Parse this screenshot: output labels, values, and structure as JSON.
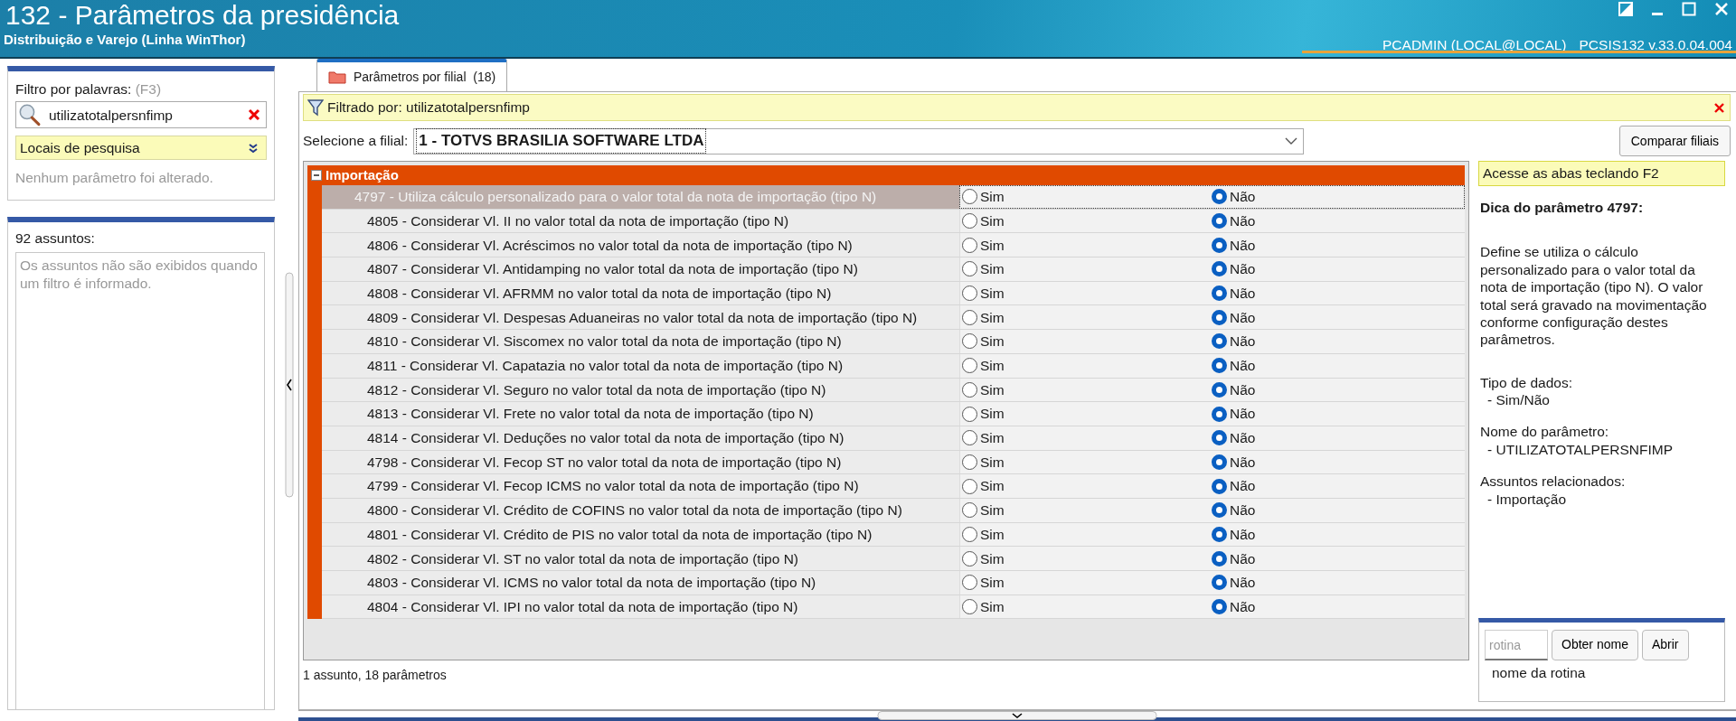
{
  "window": {
    "title": "132 - Parâmetros da presidência",
    "subtitle": "Distribuição e Varejo (Linha WinThor)",
    "user_info": "PCADMIN (LOCAL@LOCAL)",
    "version": "PCSIS132  v.33.0.04.004"
  },
  "filter_panel": {
    "label": "Filtro por palavras:",
    "shortcut": "(F3)",
    "search_value": "utilizatotalpersnfimp",
    "search_places": "Locais de pesquisa",
    "status": "Nenhum parâmetro foi alterado."
  },
  "subjects_panel": {
    "label": "92 assuntos:",
    "message": "Os assuntos não são exibidos quando um filtro é informado."
  },
  "tabs": [
    {
      "label": "Parâmetros por filial",
      "count": "(18)",
      "selected": true
    }
  ],
  "filter_bar": {
    "text": "Filtrado por: utilizatotalpersnfimp"
  },
  "branch": {
    "label": "Selecione a filial:",
    "value": "1 - TOTVS BRASILIA SOFTWARE LTDA",
    "compare_button": "Comparar filiais"
  },
  "group": {
    "title": "Importação",
    "expanded": true,
    "rows": [
      {
        "label": "4797 - Utiliza cálculo personalizado para o valor total da nota de importação (tipo N)",
        "selected": true,
        "child": false,
        "options": [
          {
            "label": "Sim",
            "selected": false
          },
          {
            "label": "Não",
            "selected": true
          }
        ]
      },
      {
        "label": "4805 - Considerar Vl. II no valor total da nota de importação (tipo N)",
        "selected": false,
        "child": true,
        "options": [
          {
            "label": "Sim",
            "selected": false
          },
          {
            "label": "Não",
            "selected": true
          }
        ]
      },
      {
        "label": "4806 - Considerar Vl. Acréscimos no valor total da nota de importação (tipo N)",
        "selected": false,
        "child": true,
        "options": [
          {
            "label": "Sim",
            "selected": false
          },
          {
            "label": "Não",
            "selected": true
          }
        ]
      },
      {
        "label": "4807 - Considerar Vl. Antidamping no valor total da nota de importação (tipo N)",
        "selected": false,
        "child": true,
        "options": [
          {
            "label": "Sim",
            "selected": false
          },
          {
            "label": "Não",
            "selected": true
          }
        ]
      },
      {
        "label": "4808 - Considerar Vl. AFRMM no valor total da nota de importação (tipo N)",
        "selected": false,
        "child": true,
        "options": [
          {
            "label": "Sim",
            "selected": false
          },
          {
            "label": "Não",
            "selected": true
          }
        ]
      },
      {
        "label": "4809 - Considerar Vl. Despesas Aduaneiras no valor total da nota de importação (tipo N)",
        "selected": false,
        "child": true,
        "options": [
          {
            "label": "Sim",
            "selected": false
          },
          {
            "label": "Não",
            "selected": true
          }
        ]
      },
      {
        "label": "4810 - Considerar Vl. Siscomex no valor total da nota de importação (tipo N)",
        "selected": false,
        "child": true,
        "options": [
          {
            "label": "Sim",
            "selected": false
          },
          {
            "label": "Não",
            "selected": true
          }
        ]
      },
      {
        "label": "4811 - Considerar Vl. Capatazia no valor total da nota de importação (tipo N)",
        "selected": false,
        "child": true,
        "options": [
          {
            "label": "Sim",
            "selected": false
          },
          {
            "label": "Não",
            "selected": true
          }
        ]
      },
      {
        "label": "4812 - Considerar Vl. Seguro no valor total da nota de importação (tipo N)",
        "selected": false,
        "child": true,
        "options": [
          {
            "label": "Sim",
            "selected": false
          },
          {
            "label": "Não",
            "selected": true
          }
        ]
      },
      {
        "label": "4813 - Considerar Vl. Frete no valor total da nota de importação (tipo N)",
        "selected": false,
        "child": true,
        "options": [
          {
            "label": "Sim",
            "selected": false
          },
          {
            "label": "Não",
            "selected": true
          }
        ]
      },
      {
        "label": "4814 - Considerar Vl. Deduções no valor total da nota de importação (tipo N)",
        "selected": false,
        "child": true,
        "options": [
          {
            "label": "Sim",
            "selected": false
          },
          {
            "label": "Não",
            "selected": true
          }
        ]
      },
      {
        "label": "4798 - Considerar Vl. Fecop ST no valor total da nota de importação (tipo N)",
        "selected": false,
        "child": true,
        "options": [
          {
            "label": "Sim",
            "selected": false
          },
          {
            "label": "Não",
            "selected": true
          }
        ]
      },
      {
        "label": "4799 - Considerar Vl. Fecop ICMS  no valor total da nota de importação (tipo N)",
        "selected": false,
        "child": true,
        "options": [
          {
            "label": "Sim",
            "selected": false
          },
          {
            "label": "Não",
            "selected": true
          }
        ]
      },
      {
        "label": "4800 - Considerar Vl. Crédito de COFINS no valor total da nota de importação (tipo N)",
        "selected": false,
        "child": true,
        "options": [
          {
            "label": "Sim",
            "selected": false
          },
          {
            "label": "Não",
            "selected": true
          }
        ]
      },
      {
        "label": "4801 - Considerar Vl. Crédito de PIS no valor total da nota de importação (tipo N)",
        "selected": false,
        "child": true,
        "options": [
          {
            "label": "Sim",
            "selected": false
          },
          {
            "label": "Não",
            "selected": true
          }
        ]
      },
      {
        "label": "4802 - Considerar Vl. ST no valor total da nota de importação (tipo N)",
        "selected": false,
        "child": true,
        "options": [
          {
            "label": "Sim",
            "selected": false
          },
          {
            "label": "Não",
            "selected": true
          }
        ]
      },
      {
        "label": "4803 - Considerar Vl. ICMS no valor total da nota de importação (tipo N)",
        "selected": false,
        "child": true,
        "options": [
          {
            "label": "Sim",
            "selected": false
          },
          {
            "label": "Não",
            "selected": true
          }
        ]
      },
      {
        "label": "4804 - Considerar Vl. IPI no valor total da nota de importação (tipo N)",
        "selected": false,
        "child": true,
        "options": [
          {
            "label": "Sim",
            "selected": false
          },
          {
            "label": "Não",
            "selected": true
          }
        ]
      }
    ]
  },
  "status_bar": "1 assunto, 18 parâmetros",
  "hint_panel": {
    "banner": "Acesse as abas teclando F2",
    "title": "Dica do parâmetro 4797:",
    "description": "Define se utiliza o cálculo personalizado para o valor total da nota de importação (tipo N). O valor total será gravado na movimentação conforme configuração destes parâmetros.",
    "sections": [
      {
        "heading": "Tipo de dados:",
        "value": "- Sim/Não"
      },
      {
        "heading": "Nome do parâmetro:",
        "value": "- UTILIZATOTALPERSNFIMP"
      },
      {
        "heading": "Assuntos relacionados:",
        "value": "- Importação"
      }
    ]
  },
  "routine_box": {
    "placeholder": "rotina",
    "buttons": [
      "Obter nome",
      "Abrir"
    ],
    "caption": "nome da rotina"
  }
}
